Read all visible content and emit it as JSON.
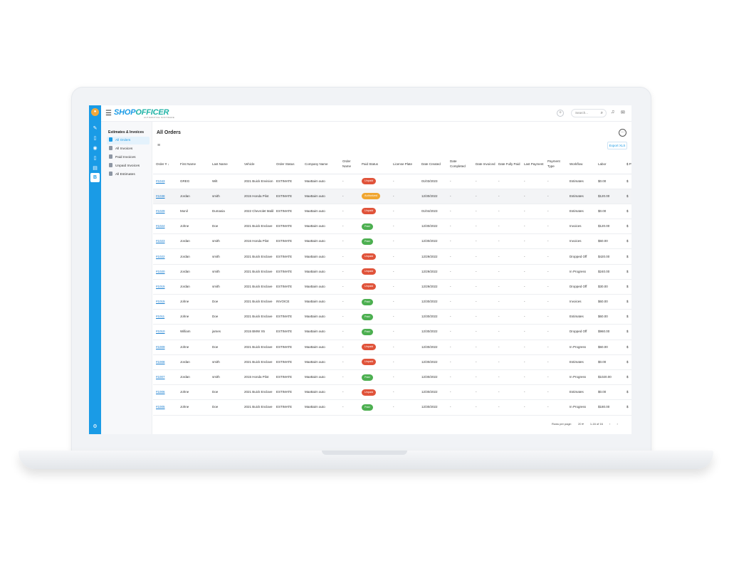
{
  "app": {
    "logo_main": "SHOP",
    "logo_accent": "OFFICER",
    "logo_sub": "AUTOMOTIVE SOFTWARE"
  },
  "header": {
    "search_placeholder": "Search...",
    "plus_label": "+"
  },
  "sidebar": {
    "section_title": "Estimates & Invoices",
    "items": [
      {
        "label": "All Orders",
        "active": true
      },
      {
        "label": "All Invoices",
        "active": false
      },
      {
        "label": "Paid Invoices",
        "active": false
      },
      {
        "label": "Unpaid Invoices",
        "active": false
      },
      {
        "label": "All Estimates",
        "active": false
      }
    ]
  },
  "main": {
    "title": "All Orders",
    "more_label": "···",
    "export_label": "Export XLS"
  },
  "table": {
    "columns": [
      "Order # ↓",
      "First Name",
      "Last Name",
      "Vehicle",
      "Order Status",
      "Company Name",
      "Order Name",
      "Paid Status",
      "License Plate",
      "Date Created",
      "Date Completed",
      "Date Invoiced",
      "Date Fully Paid",
      "Last Payment",
      "Payment Type",
      "Workflow",
      "Labor",
      "$ P"
    ],
    "rows": [
      [
        "#1043",
        "GREG",
        "Wilt",
        "2021 Buick Envision",
        "ESTIMATE",
        "MaxBaim auto",
        "-",
        "Unpaid",
        "-",
        "01/03/2023",
        "-",
        "-",
        "-",
        "-",
        "-",
        "Estimates",
        "$0.00",
        "$"
      ],
      [
        "#1038",
        "Jordan",
        "smith",
        "2015 Honda Pilot",
        "ESTIMATE",
        "MaxBaim auto",
        "-",
        "Authorized",
        "-",
        "12/30/2022",
        "-",
        "-",
        "-",
        "-",
        "-",
        "Estimates",
        "$120.00",
        "$"
      ],
      [
        "#1029",
        "Monil",
        "Dumasia",
        "2022 Chevrolet Malibu",
        "ESTIMATE",
        "MaxBaim auto",
        "-",
        "Unpaid",
        "-",
        "01/04/2023",
        "-",
        "-",
        "-",
        "-",
        "-",
        "Estimates",
        "$0.00",
        "$"
      ],
      [
        "#1024",
        "Johne",
        "Doe",
        "2021 Buick Enclave",
        "ESTIMATE",
        "MaxBaim auto",
        "-",
        "Paid",
        "-",
        "12/30/2022",
        "-",
        "-",
        "-",
        "-",
        "-",
        "Invoices",
        "$120.00",
        "$"
      ],
      [
        "#1023",
        "Jordan",
        "smith",
        "2015 Honda Pilot",
        "ESTIMATE",
        "MaxBaim auto",
        "-",
        "Paid",
        "-",
        "12/30/2022",
        "-",
        "-",
        "-",
        "-",
        "-",
        "Invoices",
        "$60.00",
        "$"
      ],
      [
        "#1022",
        "Jordan",
        "smith",
        "2021 Buick Enclave",
        "ESTIMATE",
        "MaxBaim auto",
        "-",
        "Unpaid",
        "-",
        "12/29/2022",
        "-",
        "-",
        "-",
        "-",
        "-",
        "Dropped Off",
        "$420.00",
        "$"
      ],
      [
        "#1020",
        "Jordan",
        "smith",
        "2021 Buick Enclave",
        "ESTIMATE",
        "MaxBaim auto",
        "-",
        "Unpaid",
        "-",
        "12/29/2022",
        "-",
        "-",
        "-",
        "-",
        "-",
        "In Progress",
        "$240.00",
        "$"
      ],
      [
        "#1015",
        "Jordan",
        "smith",
        "2021 Buick Enclave",
        "ESTIMATE",
        "MaxBaim auto",
        "-",
        "Unpaid",
        "-",
        "12/29/2022",
        "-",
        "-",
        "-",
        "-",
        "-",
        "Dropped Off",
        "$30.00",
        "$"
      ],
      [
        "#1015",
        "Johne",
        "Doe",
        "2021 Buick Enclave",
        "INVOICE",
        "MaxBaim auto",
        "-",
        "Paid",
        "-",
        "12/30/2022",
        "-",
        "-",
        "-",
        "-",
        "-",
        "Invoices",
        "$60.00",
        "$"
      ],
      [
        "#1011",
        "Johne",
        "Doe",
        "2021 Buick Enclave",
        "ESTIMATE",
        "MaxBaim auto",
        "-",
        "Paid",
        "-",
        "12/30/2022",
        "-",
        "-",
        "-",
        "-",
        "-",
        "Estimates",
        "$60.00",
        "$"
      ],
      [
        "#1010",
        "William",
        "james",
        "2015 BMW X5",
        "ESTIMATE",
        "MaxBaim auto",
        "-",
        "Paid",
        "-",
        "12/30/2022",
        "-",
        "-",
        "-",
        "-",
        "-",
        "Dropped Off",
        "$960.00",
        "$"
      ],
      [
        "#1009",
        "Johne",
        "Doe",
        "2021 Buick Enclave",
        "ESTIMATE",
        "MaxBaim auto",
        "-",
        "Unpaid",
        "-",
        "12/30/2022",
        "-",
        "-",
        "-",
        "-",
        "-",
        "In Progress",
        "$60.00",
        "$"
      ],
      [
        "#1008",
        "Jordan",
        "smith",
        "2021 Buick Enclave",
        "ESTIMATE",
        "MaxBaim auto",
        "-",
        "Unpaid",
        "-",
        "12/30/2022",
        "-",
        "-",
        "-",
        "-",
        "-",
        "Estimates",
        "$0.00",
        "$"
      ],
      [
        "#1007",
        "Jordan",
        "smith",
        "2015 Honda Pilot",
        "ESTIMATE",
        "MaxBaim auto",
        "-",
        "Paid",
        "-",
        "12/30/2022",
        "-",
        "-",
        "-",
        "-",
        "-",
        "In Progress",
        "$1020.00",
        "$"
      ],
      [
        "#1006",
        "Johne",
        "Doe",
        "2021 Buick Enclave",
        "ESTIMATE",
        "MaxBaim auto",
        "-",
        "Unpaid",
        "-",
        "12/30/2022",
        "-",
        "-",
        "-",
        "-",
        "-",
        "Estimates",
        "$0.00",
        "$"
      ],
      [
        "#1005",
        "Johne",
        "Doe",
        "2021 Buick Enclave",
        "ESTIMATE",
        "MaxBaim auto",
        "-",
        "Paid",
        "-",
        "12/30/2022",
        "-",
        "-",
        "-",
        "-",
        "-",
        "In Progress",
        "$180.00",
        "$"
      ]
    ]
  },
  "pager": {
    "rows_label": "Rows per page:",
    "rows_value": "20 ▾",
    "range": "1-16 of 16",
    "prev": "‹",
    "next": "›"
  },
  "colors": {
    "brand": "#1a9be6",
    "unpaid": "#e0533a",
    "paid": "#4caf50",
    "authorized": "#f0a630"
  }
}
